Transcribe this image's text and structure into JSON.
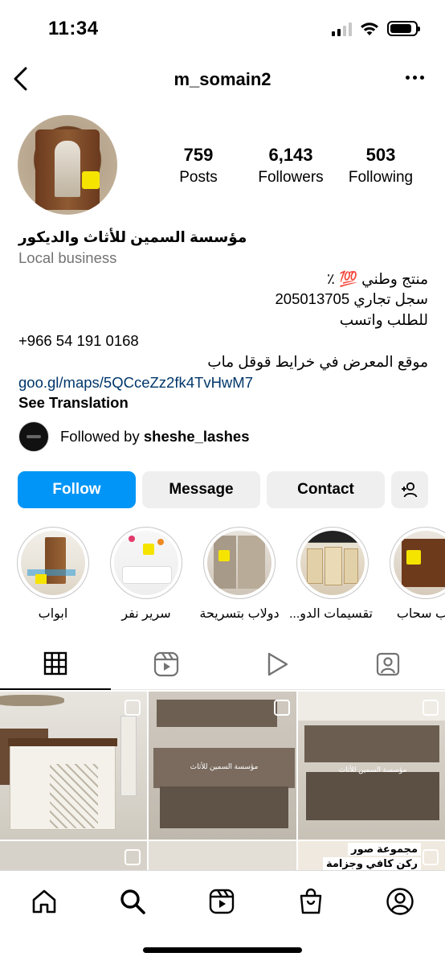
{
  "status_bar": {
    "time": "11:34"
  },
  "header": {
    "username": "m_somain2"
  },
  "stats": {
    "posts": {
      "count": "759",
      "label": "Posts"
    },
    "followers": {
      "count": "6,143",
      "label": "Followers"
    },
    "following": {
      "count": "503",
      "label": "Following"
    }
  },
  "bio": {
    "name": "مؤسسة السمين للأثاث والديكور",
    "category": "Local business",
    "lines": [
      "منتج وطني 💯 ٪",
      "سجل تجاري 205013705",
      "للطلب واتسب",
      "+966 54 191 0168",
      "موقع المعرض في خرايط قوقل ماب"
    ],
    "link": "goo.gl/maps/5QCceZz2fk4TvHwM7",
    "see_translation": "See Translation"
  },
  "followed_by": {
    "prefix": "Followed by ",
    "user": "sheshe_lashes"
  },
  "buttons": {
    "follow": "Follow",
    "message": "Message",
    "contact": "Contact"
  },
  "highlights": [
    {
      "label": "ابواب"
    },
    {
      "label": "سرير نفر"
    },
    {
      "label": "دولاب بتسريحة"
    },
    {
      "label": "تقسيمات الدو..."
    },
    {
      "label": "لاب سحاب"
    }
  ],
  "grid_overlay": {
    "post2_caption": "مؤسسة السمين للأثاث",
    "post3_caption": "مؤسسة السمين للأثاث",
    "post6_line1": "مجموعة صور",
    "post6_line2": "ركن كافي وجزامة"
  },
  "icons": {
    "back": "chevron-left-icon",
    "more": "more-horizontal-icon",
    "add_user": "add-user-icon",
    "grid_tab": "grid-icon",
    "reels_tab": "reels-icon",
    "play_tab": "play-icon",
    "tagged_tab": "tagged-person-icon",
    "nav_home": "home-icon",
    "nav_search": "search-icon",
    "nav_reels": "reels-icon",
    "nav_shop": "shop-bag-icon",
    "nav_profile": "profile-icon"
  },
  "colors": {
    "follow_button": "#0095f6",
    "link": "#00376b",
    "category": "#737373",
    "secondary_button": "#efefef"
  }
}
